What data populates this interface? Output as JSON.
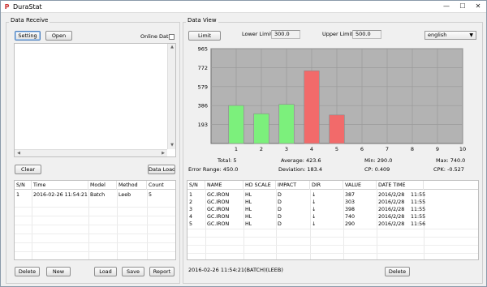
{
  "window": {
    "title": "DuraStat",
    "minimize": "—",
    "maximize": "☐",
    "close": "✕"
  },
  "receive": {
    "group_title": "Data Receive",
    "setting_label": "Setting",
    "open_label": "Open",
    "online_label": "Online Data",
    "online_checked": false,
    "clear_label": "Clear",
    "dataload_label": "Data Load",
    "columns": [
      "S/N",
      "Time",
      "Model",
      "Method",
      "Count"
    ],
    "rows": [
      [
        "1",
        "2016-02-26 11:54:21",
        "Batch",
        "Leeb",
        "5"
      ]
    ],
    "delete_label": "Delete",
    "new_label": "New",
    "load_label": "Load",
    "save_label": "Save",
    "report_label": "Report"
  },
  "view": {
    "group_title": "Data View",
    "limit_label": "Limit",
    "lower_label": "Lower Limit:",
    "lower_value": "300.0",
    "upper_label": "Upper Limit:",
    "upper_value": "500.0",
    "language_value": "english",
    "stats": {
      "total": "Total: 5",
      "average": "Average: 423.6",
      "min": "Min: 290.0",
      "max": "Max: 740.0",
      "error_range": "Error Range: 450.0",
      "deviation": "Deviation: 183.4",
      "cp": "CP: 0.409",
      "cpk": "CPK: -0.527"
    },
    "columns": [
      "S/N",
      "NAME",
      "HD SCALE",
      "IMPACT",
      "DIR",
      "VALUE",
      "DATE TIME"
    ],
    "rows": [
      [
        "1",
        "GC.IRON",
        "HL",
        "D",
        "↓",
        "387",
        "2016/2/28",
        "11:55"
      ],
      [
        "2",
        "GC.IRON",
        "HL",
        "D",
        "↓",
        "303",
        "2016/2/28",
        "11:55"
      ],
      [
        "3",
        "GC.IRON",
        "HL",
        "D",
        "↓",
        "398",
        "2016/2/28",
        "11:55"
      ],
      [
        "4",
        "GC.IRON",
        "HL",
        "D",
        "↓",
        "740",
        "2016/2/28",
        "11:55"
      ],
      [
        "5",
        "GC.IRON",
        "HL",
        "D",
        "↓",
        "290",
        "2016/2/28",
        "11:56"
      ]
    ],
    "status_text": "2016-02-26 11:54:21(BATCH)(LEEB)",
    "delete_label": "Delete"
  },
  "colors": {
    "in_limit": "#7cf07c",
    "out_limit": "#f26a6a",
    "plot_bg": "#b3b3b3"
  },
  "chart_data": {
    "type": "bar",
    "title": "",
    "xlabel": "",
    "ylabel": "",
    "x_ticks": [
      "1",
      "2",
      "3",
      "4",
      "5",
      "6",
      "7",
      "8",
      "9",
      "10"
    ],
    "y_ticks": [
      "193",
      "386",
      "579",
      "772",
      "965"
    ],
    "xlim": [
      0,
      10
    ],
    "ylim": [
      0,
      965
    ],
    "grid": true,
    "series": [
      {
        "x": [
          1,
          2,
          3,
          4,
          5
        ],
        "values": [
          387,
          303,
          398,
          740,
          290
        ],
        "colors": [
          "#7cf07c",
          "#7cf07c",
          "#7cf07c",
          "#f26a6a",
          "#f26a6a"
        ]
      }
    ]
  }
}
